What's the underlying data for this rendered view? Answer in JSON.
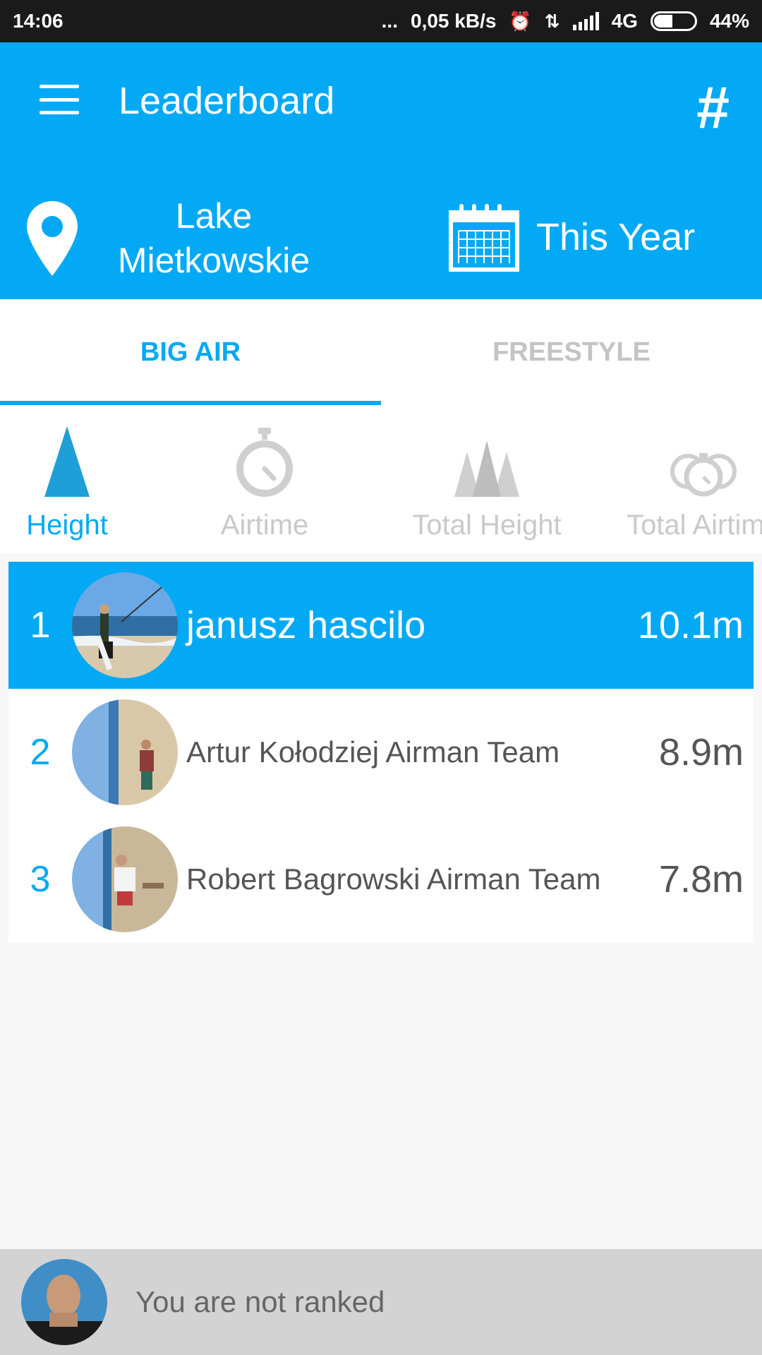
{
  "status_bar": {
    "time": "14:06",
    "dots": "...",
    "speed": "0,05 kB/s",
    "network": "4G",
    "battery": "44%",
    "battery_level": 0.44
  },
  "app_bar": {
    "title": "Leaderboard",
    "hash_label": "#",
    "location": "Lake Mietkowskie",
    "period": "This Year"
  },
  "tabs": [
    {
      "label": "BIG AIR",
      "active": true
    },
    {
      "label": "FREESTYLE",
      "active": false
    }
  ],
  "metrics": [
    {
      "label": "Height",
      "icon": "triangle-icon",
      "active": true
    },
    {
      "label": "Airtime",
      "icon": "stopwatch-icon",
      "active": false
    },
    {
      "label": "Total Height",
      "icon": "mountains-icon",
      "active": false
    },
    {
      "label": "Total Airtime",
      "icon": "stopwatches-icon",
      "active": false
    }
  ],
  "leaderboard": [
    {
      "rank": "1",
      "name": "janusz hascilo",
      "value": "10.1m",
      "highlight": true
    },
    {
      "rank": "2",
      "name": "Artur Kołodziej Airman Team",
      "value": "8.9m",
      "highlight": false
    },
    {
      "rank": "3",
      "name": "Robert Bagrowski Airman Team",
      "value": "7.8m",
      "highlight": false
    }
  ],
  "footer": {
    "text": "You are not ranked"
  },
  "colors": {
    "accent": "#03a9f4",
    "inactive": "#c9c9c9",
    "status_bar": "#1a1a1a",
    "footer_bg": "#d3d3d3"
  }
}
